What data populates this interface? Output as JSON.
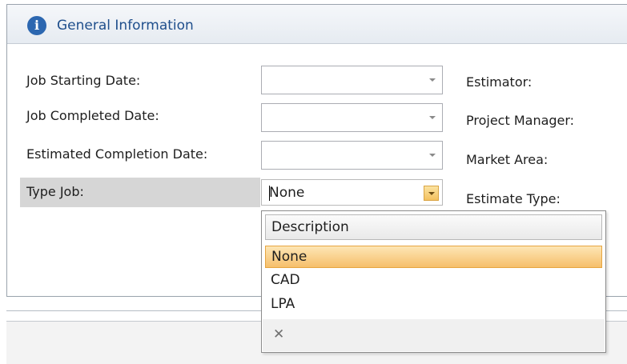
{
  "panel": {
    "title": "General Information",
    "icon": "info-icon"
  },
  "fields": {
    "job_starting_date": {
      "label": "Job Starting Date:",
      "value": ""
    },
    "job_completed_date": {
      "label": "Job Completed Date:",
      "value": ""
    },
    "estimated_completion_date": {
      "label": "Estimated Completion Date:",
      "value": ""
    },
    "type_job": {
      "label": "Type Job:",
      "value": "None"
    }
  },
  "right_labels": {
    "estimator": "Estimator:",
    "project_manager": "Project Manager:",
    "market_area": "Market Area:",
    "estimate_type": "Estimate Type:"
  },
  "dropdown": {
    "column_header": "Description",
    "options": [
      "None",
      "CAD",
      "LPA"
    ],
    "selected": "None",
    "clear_symbol": "✕"
  },
  "colors": {
    "header_title": "#1f4f8c",
    "info_icon": "#2c67b0",
    "selection_highlight": "#f6bf6b",
    "row_highlight": "#d6d6d6"
  }
}
